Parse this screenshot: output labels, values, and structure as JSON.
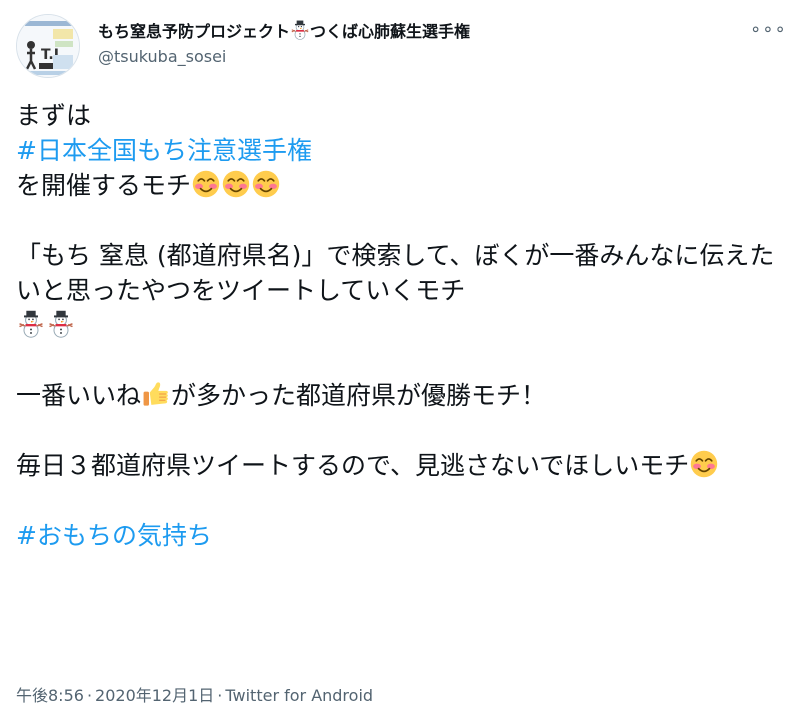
{
  "user": {
    "display_name": "もち窒息予防プロジェクト",
    "display_name_suffix": "つくば心肺蘇生選手権",
    "handle": "@tsukuba_sosei"
  },
  "menu": {
    "more_label": "∘∘∘"
  },
  "tweet": {
    "line1": "まずは",
    "hashtag1": "#日本全国もち注意選手権",
    "line3": "を開催するモチ",
    "para2": "「もち 窒息 (都道府県名)」で検索して、ぼくが一番みんなに伝えたいと思ったやつをツイートしていくモチ",
    "para3_a": "一番いいね",
    "para3_b": "が多かった都道府県が優勝モチ！",
    "para4": "毎日３都道府県ツイートするので、見逃さないでほしいモチ",
    "hashtag2": "#おもちの気持ち"
  },
  "meta": {
    "time": "午後8:56",
    "date": "2020年12月1日",
    "source": "Twitter for Android",
    "separator": "·"
  },
  "icons": [
    "smiling-face-icon",
    "snowman-icon",
    "thumbs-up-icon"
  ],
  "colors": {
    "hashtag": "#1d9bf0",
    "secondary_text": "#536471"
  }
}
